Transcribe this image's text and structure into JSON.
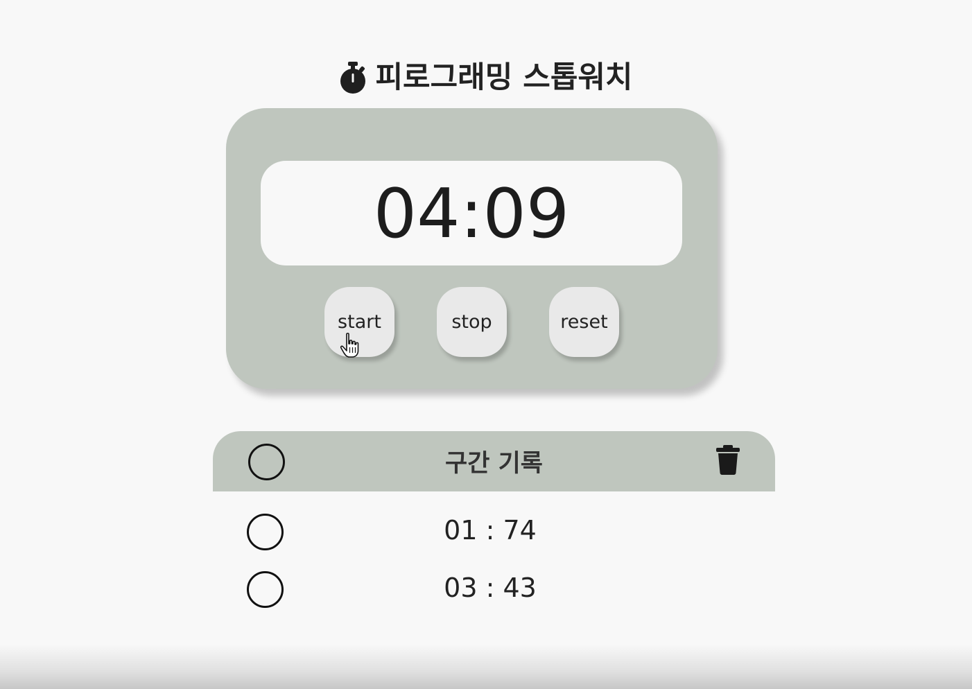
{
  "header": {
    "title": "피로그래밍 스톱워치",
    "icon": "stopwatch-icon"
  },
  "stopwatch": {
    "time": "04:09",
    "buttons": {
      "start_label": "start",
      "stop_label": "stop",
      "reset_label": "reset"
    }
  },
  "laps": {
    "title": "구간 기록",
    "delete_icon": "trash-icon",
    "records": [
      {
        "time": "01 : 74"
      },
      {
        "time": "03 : 43"
      }
    ]
  },
  "colors": {
    "background": "#f8f8f8",
    "panel": "#bfc6be",
    "display": "#f8f8f8",
    "button": "#e9e9e9",
    "text": "#222222"
  }
}
